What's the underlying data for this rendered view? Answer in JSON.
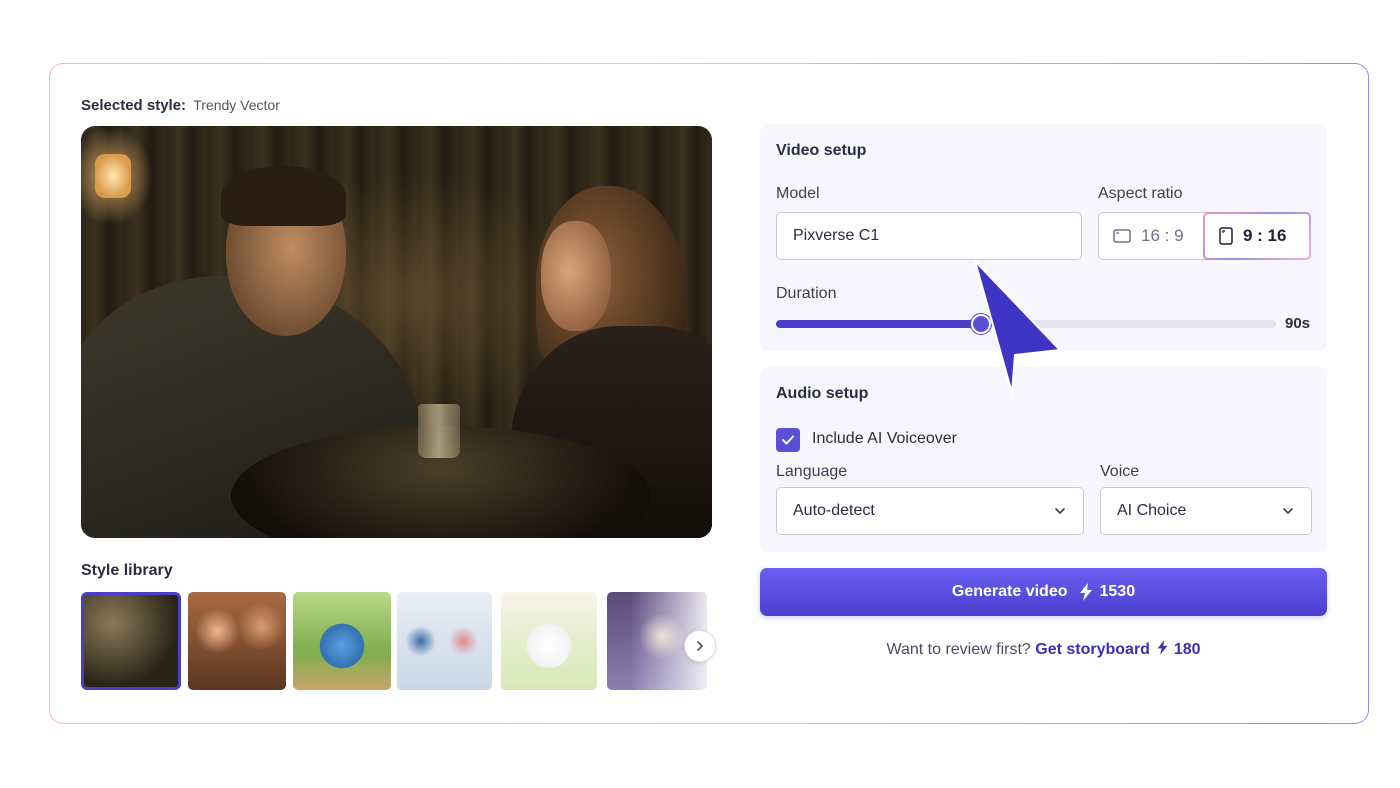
{
  "selected_style": {
    "label": "Selected style:",
    "value": "Trendy Vector"
  },
  "style_library": {
    "title": "Style library",
    "thumbnails": [
      {
        "name": "cinematic-cafe-scene",
        "selected": true
      },
      {
        "name": "cartoon-family-scene",
        "selected": false
      },
      {
        "name": "3d-robot-garden-scene",
        "selected": false
      },
      {
        "name": "flat-office-scene",
        "selected": false
      },
      {
        "name": "sketch-dog-kite-scene",
        "selected": false
      },
      {
        "name": "anime-girl-scene",
        "selected": false
      }
    ]
  },
  "video_setup": {
    "title": "Video setup",
    "model_label": "Model",
    "model_value": "Pixverse C1",
    "aspect_label": "Aspect ratio",
    "aspect_options": [
      {
        "label": "16 : 9",
        "icon": "landscape-icon",
        "selected": false
      },
      {
        "label": "9 : 16",
        "icon": "portrait-icon",
        "selected": true
      }
    ],
    "duration_label": "Duration",
    "duration_value": "90s",
    "duration_fraction": 0.41
  },
  "audio_setup": {
    "title": "Audio setup",
    "voiceover_label": "Include AI Voiceover",
    "voiceover_checked": true,
    "language_label": "Language",
    "language_value": "Auto-detect",
    "voice_label": "Voice",
    "voice_value": "AI Choice"
  },
  "generate": {
    "label": "Generate video",
    "cost": "1530",
    "icon": "lightning-icon"
  },
  "review": {
    "prompt": "Want to review first?",
    "link": "Get storyboard",
    "cost": "180"
  },
  "colors": {
    "accent": "#4a3ec9",
    "panel_bg": "#f6f6fc",
    "button_top": "#6a5ff0",
    "button_bottom": "#4b3fcf"
  }
}
